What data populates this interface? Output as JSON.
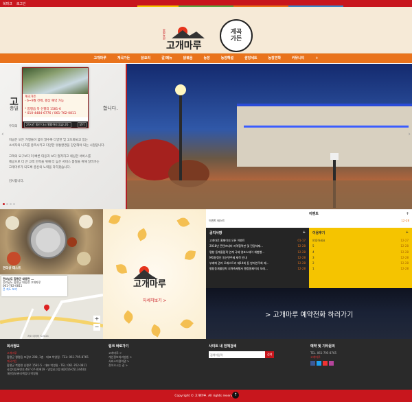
{
  "topbar": {
    "favorite": "북마크",
    "login": "로그인"
  },
  "header": {
    "brand": "고개마루",
    "brand_small": "함평농원",
    "brand2_line1": "계곡",
    "brand2_line2": "가든"
  },
  "nav": [
    "고개마루",
    "계곡가든",
    "닭요리",
    "갈/메뉴",
    "닭볶음",
    "농장",
    "농장해설",
    "쌈장세트",
    "농장견학",
    "커뮤니티",
    "+"
  ],
  "popup": {
    "title": "계곡가든",
    "lines": [
      "- 6~9월 전체, 평상 예약 가능",
      "",
      "* 함평읍 북 신평리 1581-6",
      "* 010-4484-6776 / 061-762-0811"
    ],
    "no_show": "24시간 동안 다시 열람하지 않습니다.",
    "close": "닫기"
  },
  "hero": {
    "headline": "고",
    "subline": "총밀",
    "tail": "합니다.",
    "p1": "우리의",
    "p2": "지금은 모든 가맹들이 넓이 많수록 다양한 및 고도화되고 있는",
    "p3": "소비자의 니즈를 충족시키고 다양한 유통환경을 강안해야 되는 시점입니다.",
    "p4": "고객의 요구보다 더 빠른 대응과 보다 철저하고 세심한 서비스를",
    "p5": "제공으로 더 큰 고객 만족을 위해 더 높은 서비스 품질을 위해 달려가는",
    "p6": "고개마루가 되도록 충신의 노력을 다하겠습니다.",
    "p7": "감사합니다."
  },
  "food": {
    "label": "관리상 테스트"
  },
  "map": {
    "name": "전라남도 함평군 대동면 ...",
    "addr": "전라남도 함평군 대동면 고개마루",
    "phone": "061-762-0811",
    "link": "큰 지도 보기",
    "copyright": "지도 데이터 ©2024"
  },
  "autumn": {
    "brand": "고개마루",
    "more": "자세히보기 >"
  },
  "event": {
    "title": "이벤트",
    "plus": "+",
    "item": "이벤트 테스트",
    "date": "12-28"
  },
  "notice": {
    "title": "공지사항",
    "plus": "+",
    "rows": [
      {
        "t": "고개마루 홈페이지 오픈 이벤트",
        "d": "01-17"
      },
      {
        "t": "2018년 콘텐츠네비 지역협력판 및 전망체제...",
        "d": "12-28"
      },
      {
        "t": "평창 동계올림픽 연계 국제 영초스테이 체험행...",
        "d": "12-28"
      },
      {
        "t": "MG향정인 동산면주제 제작 안내",
        "d": "12-28"
      },
      {
        "t": "부래에 관리 모래스트리 제14회 등 방지연주회 제...",
        "d": "12-28"
      },
      {
        "t": "평창동계올림픽 지역축제행사 행정원페이지 모레...",
        "d": "12-28"
      }
    ]
  },
  "review": {
    "title": "이용후기",
    "plus": "+",
    "rows": [
      {
        "t": "안녕하세요",
        "d": "12-27"
      },
      {
        "t": "5",
        "d": "12-28"
      },
      {
        "t": "4",
        "d": "12-28"
      },
      {
        "t": "3",
        "d": "12-28"
      },
      {
        "t": "2",
        "d": "12-28"
      },
      {
        "t": "1",
        "d": "12-28"
      }
    ]
  },
  "reservation": {
    "text": "> 고개마루 예약전화 하러가기"
  },
  "footer": {
    "c1_title": "회사정보",
    "c1_l1": "고개마루",
    "c1_l2": "함평군 평평읍 포장부 208, 1층 · 대표 박영필 · TEL: 061-795-8765",
    "c1_l3": "계곡가든",
    "c1_l4": "함평군 북평면 신평로 1581-5 · 대표 박영필 · TEL: 061-762-0811",
    "c1_l5": "사업자등록번호:467-07-00819 · 영업신고증:제2016-0513444호",
    "c1_l6": "개인정보관리책임자:박영필",
    "c2_title": "링크 바로가기",
    "c2_l1": "고개마루 >",
    "c2_l2": "개인정보처리방침 >",
    "c2_l3": "서비스이용약관 >",
    "c2_l4": "찾아오시는 길 >",
    "c3_title": "사이트 내 전체검색",
    "c3_placeholder": "검색어입력",
    "c3_button": "검색",
    "c4_title": "예약 및 기타문의",
    "c4_l1": "TEL. 061-795-8765",
    "c4_l2": "고개마루"
  },
  "copyright": "Copyright © 고개마루. All rights reserved.",
  "colors": {
    "brand_red": "#c8161d",
    "nav_orange": "#e9731c",
    "review_yellow": "#f5c400"
  }
}
